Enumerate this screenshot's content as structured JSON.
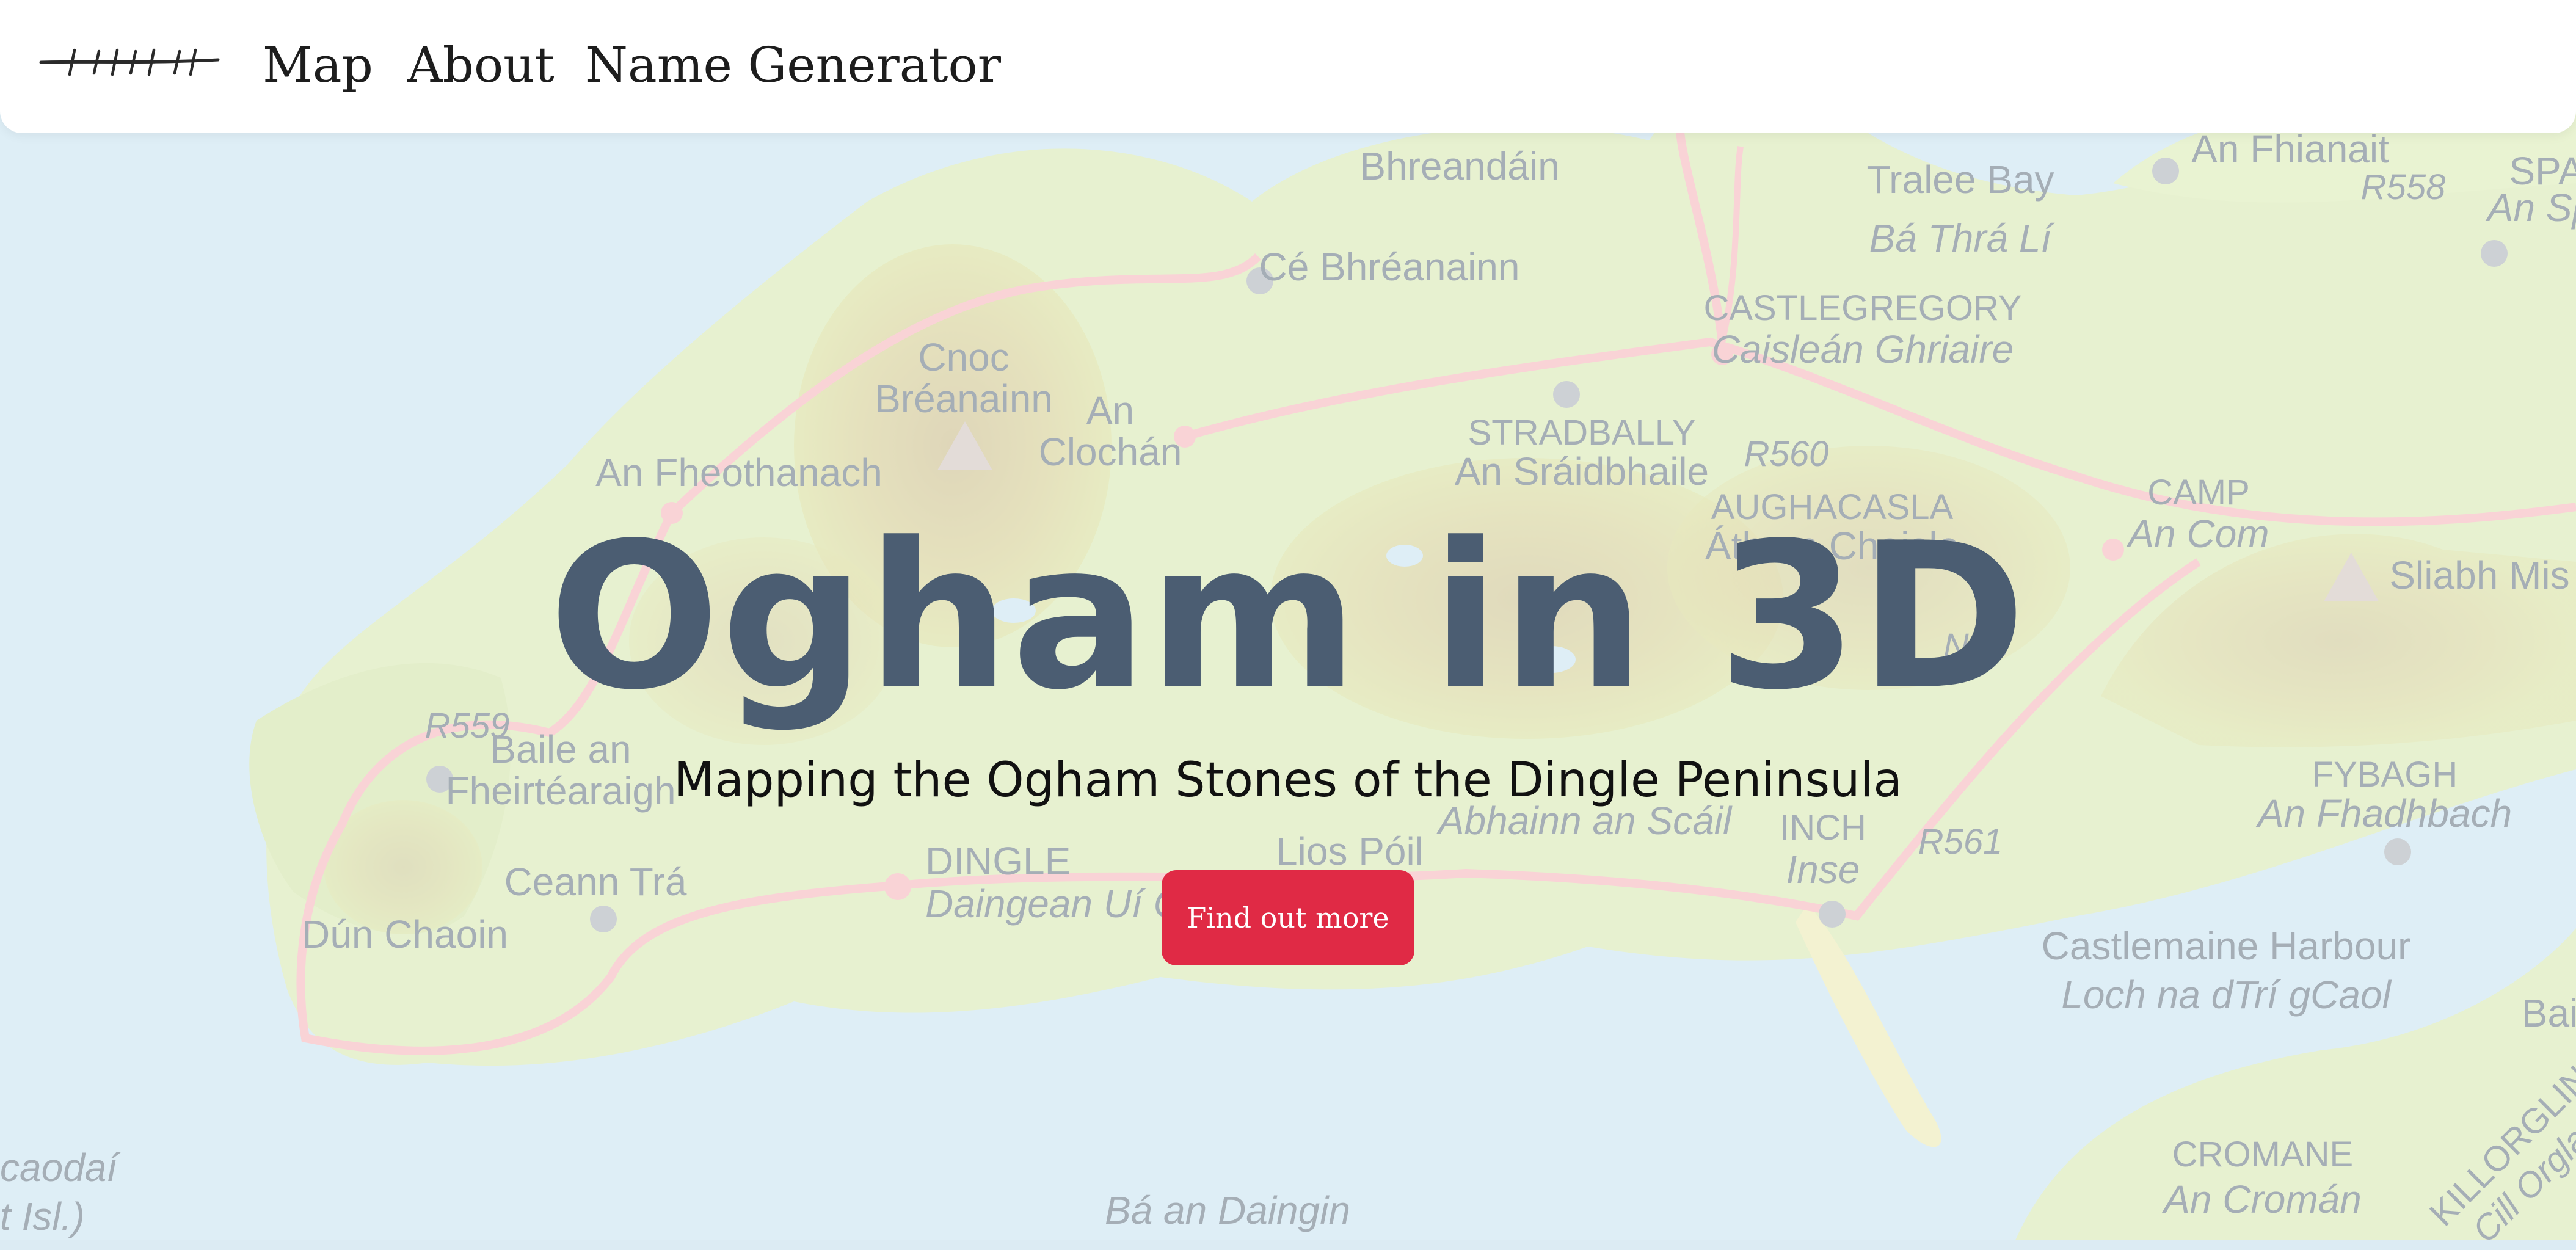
{
  "nav": {
    "logo_icon": "ogham-stroke-logo",
    "links": [
      {
        "label": "Map"
      },
      {
        "label": "About"
      },
      {
        "label": "Name Generator"
      }
    ]
  },
  "hero": {
    "title": "Ogham in 3D",
    "subtitle": "Mapping the Ogham Stones of the Dingle Peninsula",
    "cta_label": "Find out more",
    "title_color": "#4b5d72",
    "cta_color": "#e02a45"
  },
  "map": {
    "labels": [
      "Bhreandáin",
      "Tralee Bay",
      "Bá Thrá Lí",
      "An Fhianait",
      "SPA",
      "An Sp",
      "Cé Bhréanainn",
      "CASTLEGREGORY",
      "Caisleán Ghriaire",
      "Cnoc",
      "Bréanainn",
      "An",
      "Clochán",
      "STRADBALLY",
      "An Sráidbhaile",
      "R560",
      "An Fheothanach",
      "AUGHACASLA",
      "Áth an Chaisle",
      "CAMP",
      "An Com",
      "Sliabh Mis",
      "N86",
      "R559",
      "Baile an",
      "Fheirtéaraigh",
      "FYBAGH",
      "An Fhadhbach",
      "DINGLE",
      "Daingean Uí Chú",
      "Lios Póil",
      "Abhainn an Scáil",
      "INCH",
      "Inse",
      "R561",
      "Ceann Trá",
      "Dún Chaoin",
      "Castlemaine Harbour",
      "Loch na dTrí gCaol",
      "Bai",
      "CROMANE",
      "An Cromán",
      "KILLORGLIN",
      "Cill Orglan",
      "caodaí",
      "t Isl.)",
      "Bá an Daingin",
      "R558"
    ]
  }
}
